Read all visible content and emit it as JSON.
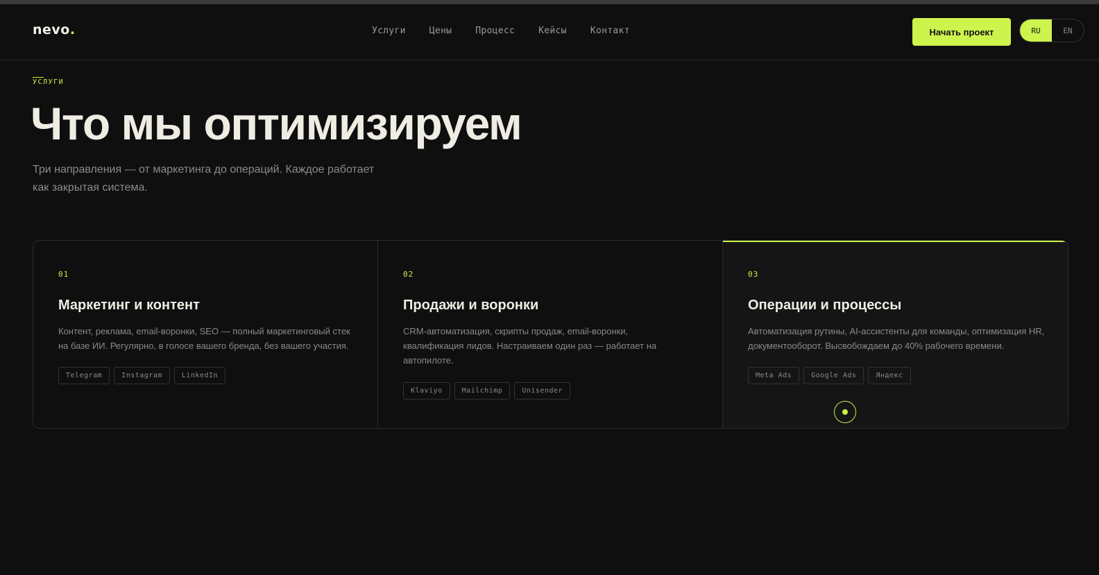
{
  "header": {
    "logo": "nevo",
    "logo_dot": ".",
    "nav": [
      "Услуги",
      "Цены",
      "Процесс",
      "Кейсы",
      "Контакт"
    ],
    "cta": "Начать проект",
    "lang": {
      "ru": "RU",
      "en": "EN",
      "active": "RU"
    }
  },
  "hero": {
    "eyebrow": "УСЛУГИ",
    "title": "Что мы оптимизируем",
    "subtitle": "Три направления — от маркетинга до операций. Каждое работает как закрытая система."
  },
  "cards": [
    {
      "num": "01",
      "title": "Маркетинг и контент",
      "desc": "Контент, реклама, email-воронки, SEO — полный маркетинговый стек на базе ИИ. Регулярно, в голосе вашего бренда, без вашего участия.",
      "tags": [
        "Telegram",
        "Instagram",
        "LinkedIn"
      ]
    },
    {
      "num": "02",
      "title": "Продажи и воронки",
      "desc": "CRM-автоматизация, скрипты продаж, email-воронки, квалификация лидов. Настраиваем один раз — работает на автопилоте.",
      "tags": [
        "Klaviyo",
        "Mailchimp",
        "Unisender"
      ]
    },
    {
      "num": "03",
      "title": "Операции и процессы",
      "desc": "Автоматизация рутины, AI-ассистенты для команды, оптимизация HR, документооборот. Высвобождаем до 40% рабочего времени.",
      "tags": [
        "Meta Ads",
        "Google Ads",
        "Яндекс"
      ]
    }
  ],
  "colors": {
    "accent": "#cdf34d",
    "background": "#0f0f0f"
  }
}
